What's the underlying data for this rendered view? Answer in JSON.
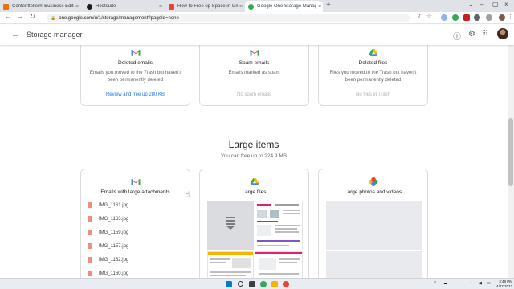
{
  "browser": {
    "tabs": [
      {
        "title": "Contentteller® Business Edition",
        "color": "#e8710a"
      },
      {
        "title": "Hootsuite",
        "color": "#1c1c1c"
      },
      {
        "title": "How to Free up Space in Gmail",
        "color": "#ea4335"
      },
      {
        "title": "Google One Storage Managem",
        "color": "#34a853"
      }
    ],
    "url": "one.google.com/u/1/storage/management?pageId=none"
  },
  "app": {
    "title": "Storage manager"
  },
  "top_cards": [
    {
      "title": "Deleted emails",
      "desc": "Emails you moved to the Trash but haven't been permanently deleted",
      "action": "Review and free up 280 KB"
    },
    {
      "title": "Spam emails",
      "desc": "Emails marked as spam",
      "action": "No spam emails"
    },
    {
      "title": "Deleted files",
      "desc": "Files you moved to the Trash but haven't been permanently deleted",
      "action": "No files in Trash"
    }
  ],
  "large_items": {
    "title": "Large items",
    "subtitle": "You can free up to 224.9 MB"
  },
  "bottom_cards": [
    {
      "title": "Emails with large attachments",
      "files": [
        "IMG_1161.jpg",
        "IMG_1163.jpg",
        "IMG_1159.jpg",
        "IMG_1157.jpg",
        "IMG_1162.jpg",
        "IMG_1160.jpg"
      ]
    },
    {
      "title": "Large files"
    },
    {
      "title": "Large photos and videos"
    }
  ],
  "taskbar": {
    "time": "3:48 PM",
    "date": "4/27/2022"
  },
  "colors": {
    "link": "#1a73e8",
    "gmail_red": "#ea4335",
    "drive_yellow": "#fbbc04",
    "drive_green": "#34a853",
    "drive_blue": "#4285f4"
  }
}
